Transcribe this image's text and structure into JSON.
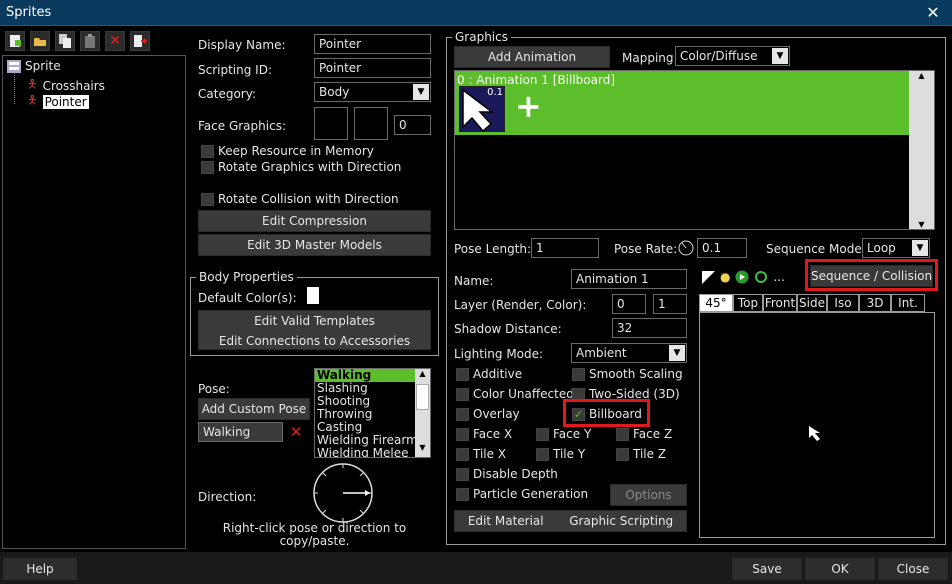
{
  "window": {
    "title": "Sprites"
  },
  "tree": {
    "root": "Sprite",
    "items": [
      "Crosshairs",
      "Pointer"
    ]
  },
  "left": {
    "display_name_label": "Display Name:",
    "display_name_value": "Pointer",
    "scripting_id_label": "Scripting ID:",
    "scripting_id_value": "Pointer",
    "category_label": "Category:",
    "category_value": "Body",
    "face_graphics_label": "Face Graphics:",
    "face_graphics_value": "0",
    "keep_resource": "Keep Resource in Memory",
    "rotate_graphics": "Rotate Graphics with Direction",
    "rotate_collision": "Rotate Collision with Direction",
    "edit_compression": "Edit Compression",
    "edit_3d_master": "Edit 3D Master Models",
    "body_props_title": "Body Properties",
    "default_colors_label": "Default Color(s):",
    "edit_valid_templates": "Edit Valid Templates",
    "edit_connections": "Edit Connections to Accessories",
    "pose_label": "Pose:",
    "add_custom_pose": "Add Custom Pose",
    "pose_value": "Walking",
    "poses": [
      "Walking",
      "Slashing",
      "Shooting",
      "Throwing",
      "Casting",
      "Wielding Firearm",
      "Wielding Melee"
    ],
    "direction_label": "Direction:",
    "hint": "Right-click pose or direction to copy/paste."
  },
  "graphics": {
    "title": "Graphics",
    "add_animation": "Add Animation",
    "mapping_label": "Mapping:",
    "mapping_value": "Color/Diffuse",
    "anim_header": "0 : Animation 1 [Billboard]",
    "frame_badge": "0.1",
    "pose_length_label": "Pose Length:",
    "pose_length_value": "1",
    "pose_rate_label": "Pose Rate:",
    "pose_rate_value": "0.1",
    "sequence_mode_label": "Sequence Mode:",
    "sequence_mode_value": "Loop",
    "name_label": "Name:",
    "name_value": "Animation 1",
    "layer_label": "Layer (Render, Color):",
    "layer_v1": "0",
    "layer_v2": "1",
    "shadow_label": "Shadow Distance:",
    "shadow_value": "32",
    "lighting_label": "Lighting Mode:",
    "lighting_value": "Ambient",
    "additive": "Additive",
    "smooth_scaling": "Smooth Scaling",
    "color_unaffected": "Color Unaffected",
    "two_sided": "Two-Sided (3D)",
    "overlay": "Overlay",
    "billboard": "Billboard",
    "face_x": "Face X",
    "face_y": "Face Y",
    "face_z": "Face Z",
    "tile_x": "Tile X",
    "tile_y": "Tile Y",
    "tile_z": "Tile Z",
    "disable_depth": "Disable Depth",
    "particle_generation": "Particle Generation",
    "options": "Options",
    "edit_material": "Edit Material",
    "graphic_scripting": "Graphic Scripting",
    "seq_collision": "Sequence / Collision",
    "view_tabs": [
      "45°",
      "Top",
      "Front",
      "Side",
      "Iso",
      "3D",
      "Int."
    ],
    "ellipsis": "..."
  },
  "footer": {
    "help": "Help",
    "save": "Save",
    "ok": "OK",
    "close": "Close"
  },
  "colors": {
    "green": "#5cbe2a",
    "title_bar": "#0a3a5e",
    "highlight": "#e01a1a"
  }
}
